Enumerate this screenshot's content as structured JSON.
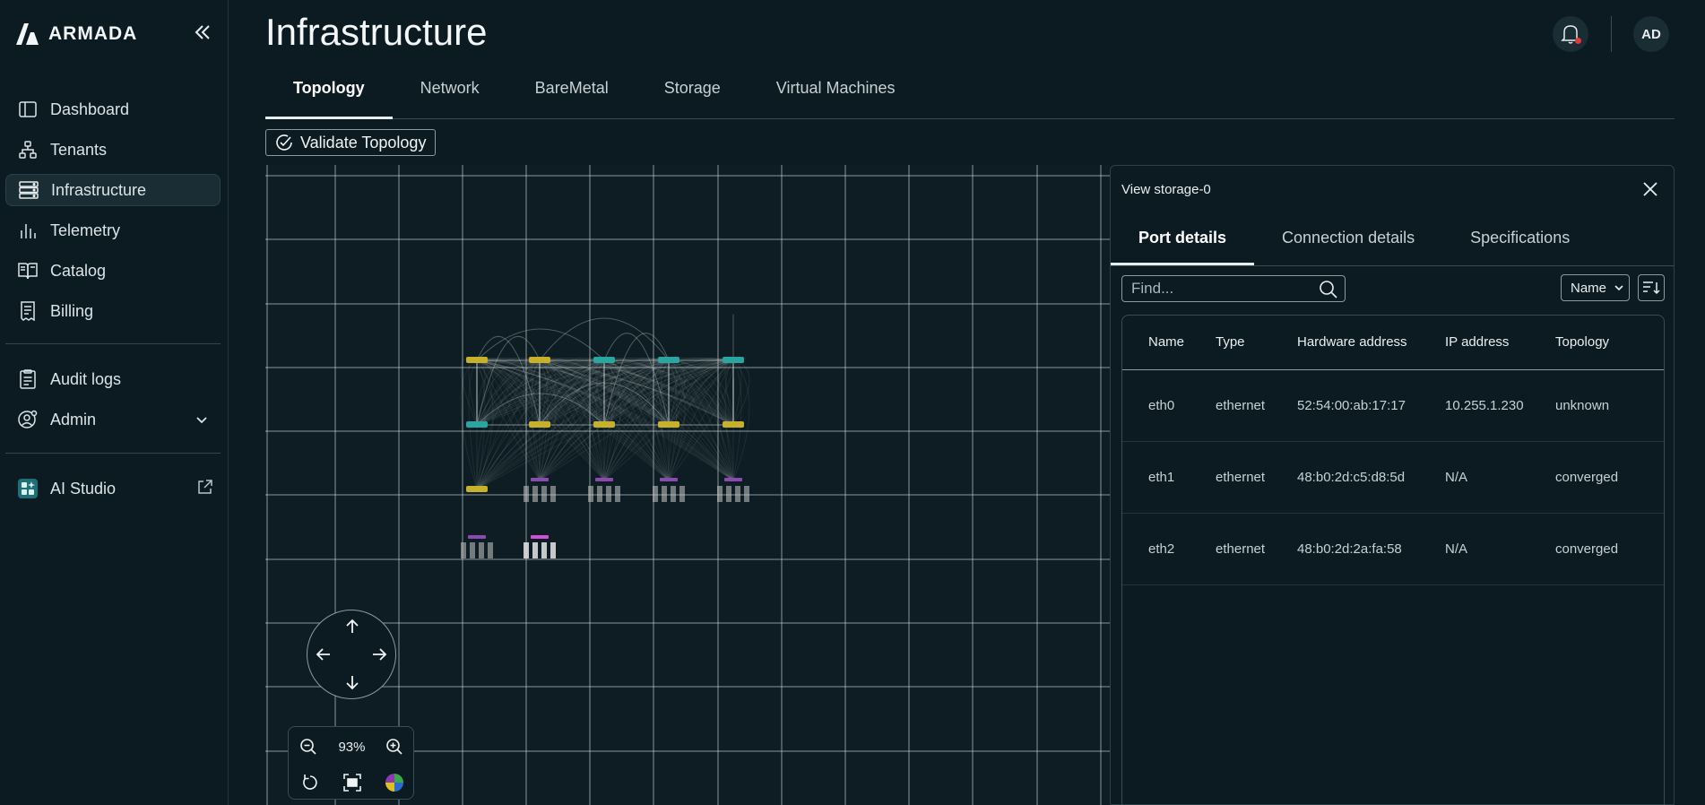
{
  "app": {
    "brand": "ARMADA"
  },
  "sidebar": {
    "items": [
      {
        "label": "Dashboard",
        "icon": "sidebar-panel-icon"
      },
      {
        "label": "Tenants",
        "icon": "org-tree-icon"
      },
      {
        "label": "Infrastructure",
        "icon": "server-stack-icon",
        "active": true
      },
      {
        "label": "Telemetry",
        "icon": "bar-chart-icon"
      },
      {
        "label": "Catalog",
        "icon": "book-icon"
      },
      {
        "label": "Billing",
        "icon": "receipt-icon"
      }
    ],
    "secondary": [
      {
        "label": "Audit logs",
        "icon": "clipboard-icon"
      },
      {
        "label": "Admin",
        "icon": "user-gear-icon"
      }
    ],
    "tools": [
      {
        "label": "AI Studio",
        "icon": "ai-studio-icon"
      }
    ]
  },
  "header": {
    "title": "Infrastructure",
    "avatar_initials": "AD"
  },
  "tabs": [
    {
      "label": "Topology",
      "active": true
    },
    {
      "label": "Network"
    },
    {
      "label": "BareMetal"
    },
    {
      "label": "Storage"
    },
    {
      "label": "Virtual Machines"
    }
  ],
  "toolbar": {
    "validate_label": "Validate Topology"
  },
  "canvas": {
    "zoom": "93%"
  },
  "panel": {
    "title": "View storage-0",
    "tabs": [
      {
        "label": "Port details",
        "active": true
      },
      {
        "label": "Connection details"
      },
      {
        "label": "Specifications"
      }
    ],
    "search_placeholder": "Find...",
    "sort_label": "Sort by",
    "sort_value": "Name",
    "table": {
      "columns": [
        "Name",
        "Type",
        "Hardware address",
        "IP address",
        "Topology"
      ],
      "rows": [
        [
          "eth0",
          "ethernet",
          "52:54:00:ab:17:17",
          "10.255.1.230",
          "unknown"
        ],
        [
          "eth1",
          "ethernet",
          "48:b0:2d:c5:d8:5d",
          "N/A",
          "converged"
        ],
        [
          "eth2",
          "ethernet",
          "48:b0:2d:2a:fa:58",
          "N/A",
          "converged"
        ]
      ]
    }
  },
  "colors": {
    "background": "#0c1b22",
    "grid": "#c9d4d6",
    "node_yellow": "#c8b12a",
    "node_teal": "#2aa6a0",
    "node_purple": "#8a4ab0",
    "bell_dot": "#e53935"
  }
}
